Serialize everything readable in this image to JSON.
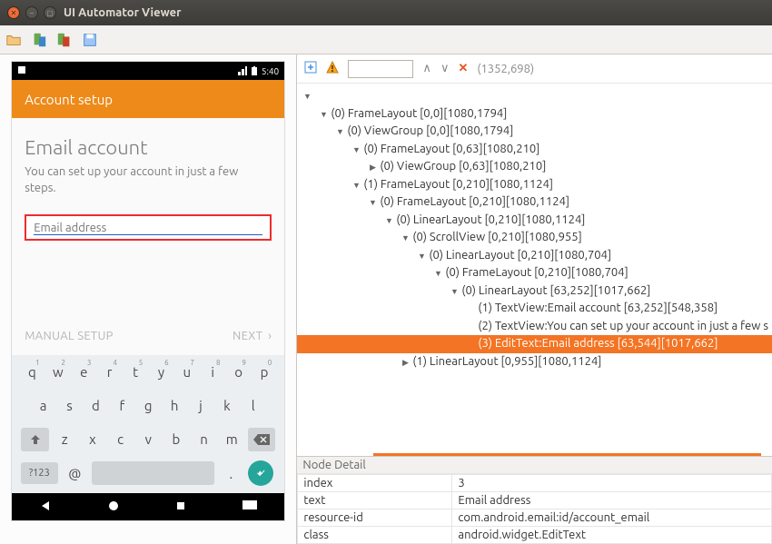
{
  "window": {
    "title": "UI Automator Viewer"
  },
  "device": {
    "statusbar": {
      "time": "5:40"
    },
    "appbar_title": "Account setup",
    "title": "Email account",
    "subtitle": "You can set up your account in just a few steps.",
    "input_placeholder": "Email address",
    "actions": {
      "manual": "MANUAL SETUP",
      "next": "NEXT"
    },
    "keyboard": {
      "row1": [
        {
          "c": "q",
          "s": "1"
        },
        {
          "c": "w",
          "s": "2"
        },
        {
          "c": "e",
          "s": "3"
        },
        {
          "c": "r",
          "s": "4"
        },
        {
          "c": "t",
          "s": "5"
        },
        {
          "c": "y",
          "s": "6"
        },
        {
          "c": "u",
          "s": "7"
        },
        {
          "c": "i",
          "s": "8"
        },
        {
          "c": "o",
          "s": "9"
        },
        {
          "c": "p",
          "s": "0"
        }
      ],
      "row2": [
        "a",
        "s",
        "d",
        "f",
        "g",
        "h",
        "j",
        "k",
        "l"
      ],
      "row3": [
        "z",
        "x",
        "c",
        "v",
        "b",
        "n",
        "m"
      ],
      "num_label": "?123",
      "at": "@",
      "dot": "."
    }
  },
  "tree_toolbar": {
    "coords": "(1352,698)"
  },
  "tree": [
    {
      "indent": 0,
      "caret": "▼",
      "text": ""
    },
    {
      "indent": 1,
      "caret": "▼",
      "text": "(0) FrameLayout [0,0][1080,1794]"
    },
    {
      "indent": 2,
      "caret": "▼",
      "text": "(0) ViewGroup [0,0][1080,1794]"
    },
    {
      "indent": 3,
      "caret": "▼",
      "text": "(0) FrameLayout [0,63][1080,210]"
    },
    {
      "indent": 4,
      "caret": "▶",
      "text": "(0) ViewGroup [0,63][1080,210]"
    },
    {
      "indent": 3,
      "caret": "▼",
      "text": "(1) FrameLayout [0,210][1080,1124]"
    },
    {
      "indent": 4,
      "caret": "▼",
      "text": "(0) FrameLayout [0,210][1080,1124]"
    },
    {
      "indent": 5,
      "caret": "▼",
      "text": "(0) LinearLayout [0,210][1080,1124]"
    },
    {
      "indent": 6,
      "caret": "▼",
      "text": "(0) ScrollView [0,210][1080,955]"
    },
    {
      "indent": 7,
      "caret": "▼",
      "text": "(0) LinearLayout [0,210][1080,704]"
    },
    {
      "indent": 8,
      "caret": "▼",
      "text": "(0) FrameLayout [0,210][1080,704]"
    },
    {
      "indent": 9,
      "caret": "▼",
      "text": "(0) LinearLayout [63,252][1017,662]"
    },
    {
      "indent": 10,
      "caret": "",
      "text": "(1) TextView:Email account [63,252][548,358]"
    },
    {
      "indent": 10,
      "caret": "",
      "text": "(2) TextView:You can set up your account in just a few s"
    },
    {
      "indent": 10,
      "caret": "",
      "text": "(3) EditText:Email address [63,544][1017,662]",
      "sel": true
    },
    {
      "indent": 6,
      "caret": "▶",
      "text": "(1) LinearLayout [0,955][1080,1124]"
    }
  ],
  "detail": {
    "title": "Node Detail",
    "rows": [
      {
        "k": "index",
        "v": "3"
      },
      {
        "k": "text",
        "v": "Email address"
      },
      {
        "k": "resource-id",
        "v": "com.android.email:id/account_email"
      },
      {
        "k": "class",
        "v": "android.widget.EditText"
      }
    ]
  }
}
